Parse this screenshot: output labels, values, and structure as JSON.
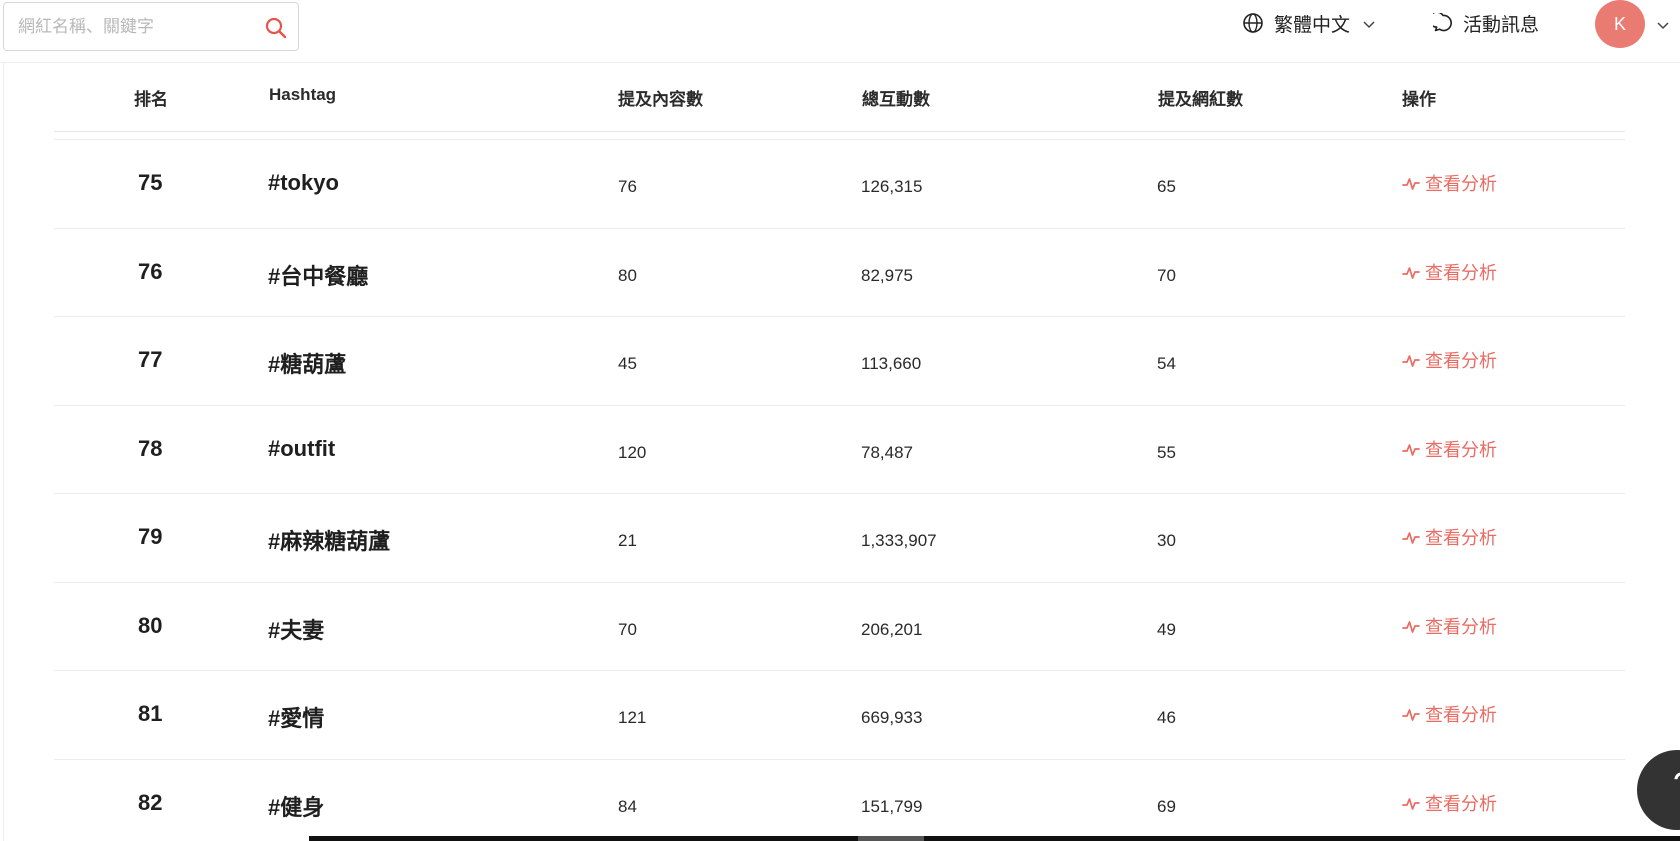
{
  "header": {
    "search_placeholder": "網紅名稱、關鍵字",
    "language_label": "繁體中文",
    "notice_label": "活動訊息",
    "avatar_initial": "K"
  },
  "table": {
    "columns": {
      "rank": "排名",
      "hashtag": "Hashtag",
      "content_count": "提及內容數",
      "interactions": "總互動數",
      "kol_count": "提及網紅數",
      "action": "操作"
    },
    "action_label": "查看分析",
    "rows": [
      {
        "rank": "75",
        "hashtag": "#tokyo",
        "content_count": "76",
        "interactions": "126,315",
        "kol_count": "65"
      },
      {
        "rank": "76",
        "hashtag": "#台中餐廳",
        "content_count": "80",
        "interactions": "82,975",
        "kol_count": "70"
      },
      {
        "rank": "77",
        "hashtag": "#糖葫蘆",
        "content_count": "45",
        "interactions": "113,660",
        "kol_count": "54"
      },
      {
        "rank": "78",
        "hashtag": "#outfit",
        "content_count": "120",
        "interactions": "78,487",
        "kol_count": "55"
      },
      {
        "rank": "79",
        "hashtag": "#麻辣糖葫蘆",
        "content_count": "21",
        "interactions": "1,333,907",
        "kol_count": "30"
      },
      {
        "rank": "80",
        "hashtag": "#夫妻",
        "content_count": "70",
        "interactions": "206,201",
        "kol_count": "49"
      },
      {
        "rank": "81",
        "hashtag": "#愛情",
        "content_count": "121",
        "interactions": "669,933",
        "kol_count": "46"
      },
      {
        "rank": "82",
        "hashtag": "#健身",
        "content_count": "84",
        "interactions": "151,799",
        "kol_count": "69"
      }
    ]
  },
  "help_label": "?",
  "colors": {
    "accent": "#ea6b62",
    "avatar_bg": "#e97b72",
    "help_bg": "#333333"
  }
}
